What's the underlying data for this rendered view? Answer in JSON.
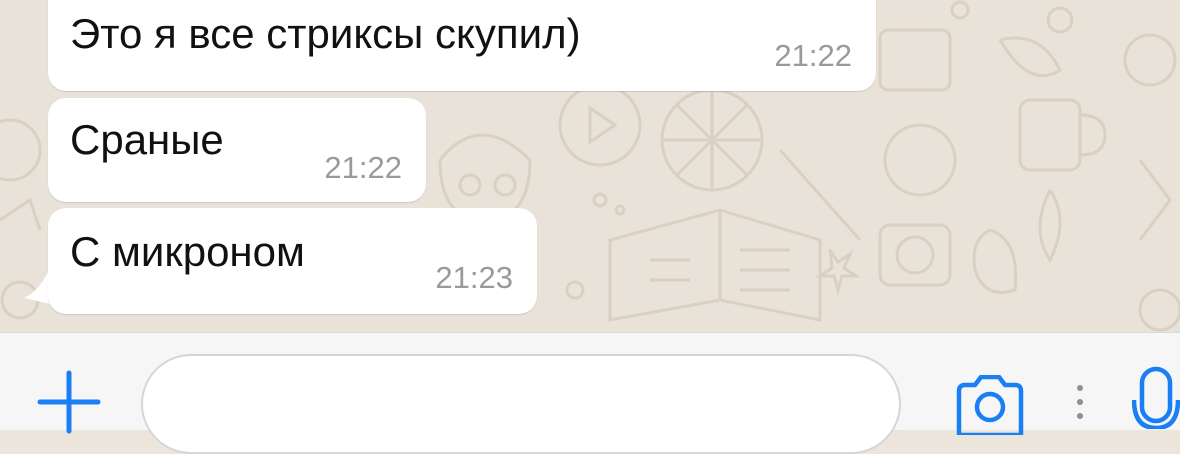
{
  "messages": [
    {
      "text": "Это я все стриксы скупил)",
      "time": "21:22"
    },
    {
      "text": "Сраные",
      "time": "21:22"
    },
    {
      "text": "С микроном",
      "time": "21:23"
    }
  ],
  "input": {
    "value": "",
    "placeholder": ""
  },
  "icons": {
    "attach": "plus-icon",
    "camera": "camera-icon",
    "more": "more-dots-icon",
    "mic": "microphone-icon"
  },
  "colors": {
    "accent": "#1a7ef4",
    "chat_background": "#e9e2d8",
    "bubble": "#ffffff",
    "timestamp": "#9a9a9a"
  }
}
